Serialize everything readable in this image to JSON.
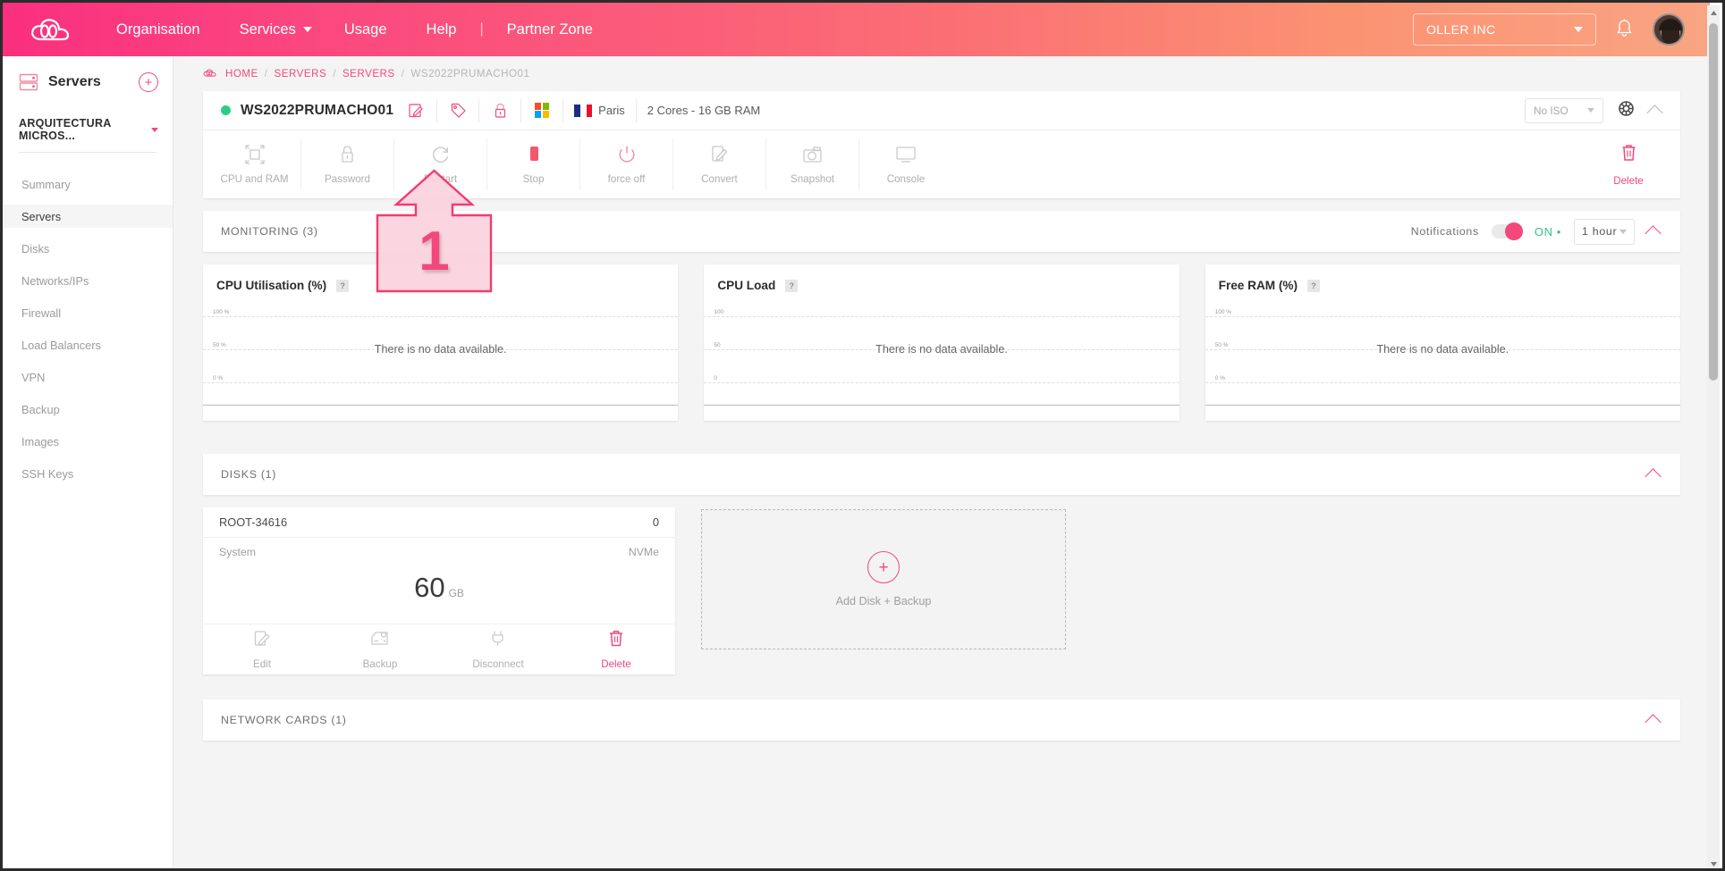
{
  "topbar": {
    "logo_icon": "cloud-logo-icon",
    "nav": [
      {
        "label": "Organisation",
        "caret": false
      },
      {
        "label": "Services",
        "caret": true
      },
      {
        "label": "Usage",
        "caret": false
      },
      {
        "label": "Help",
        "caret": false
      },
      {
        "label": "Partner Zone",
        "caret": false
      }
    ],
    "separator": "|",
    "org_selector": "OLLER INC",
    "bell_icon": "notification-bell-icon",
    "avatar_icon": "user-avatar"
  },
  "sidebar": {
    "title": "Servers",
    "title_icon": "server-rack-icon",
    "add_button": "+",
    "project": "ARQUITECTURA MICROS...",
    "items": [
      {
        "label": "Summary",
        "active": false
      },
      {
        "label": "Servers",
        "active": true
      },
      {
        "label": "Disks",
        "active": false
      },
      {
        "label": "Networks/IPs",
        "active": false
      },
      {
        "label": "Firewall",
        "active": false
      },
      {
        "label": "Load Balancers",
        "active": false
      },
      {
        "label": "VPN",
        "active": false
      },
      {
        "label": "Backup",
        "active": false
      },
      {
        "label": "Images",
        "active": false
      },
      {
        "label": "SSH Keys",
        "active": false
      }
    ]
  },
  "breadcrumb": {
    "icon": "cloud-icon",
    "items": [
      "HOME",
      "SERVERS",
      "SERVERS"
    ],
    "current": "WS2022PRUMACHO01",
    "separator": "/"
  },
  "server_header": {
    "status": "running",
    "name": "WS2022PRUMACHO01",
    "edit_icon": "edit-pencil-icon",
    "tag_icon": "tag-icon",
    "lock_icon": "lock-icon",
    "os_icon": "windows-logo-icon",
    "location": "Paris",
    "flag_icon": "france-flag-icon",
    "specs": "2 Cores - 16 GB RAM",
    "iso_select": "No ISO",
    "settings_icon": "gear-icon",
    "collapse_icon": "chevron-up-icon"
  },
  "actions": [
    {
      "label": "CPU and RAM",
      "icon": "resize-cpu-ram-icon"
    },
    {
      "label": "Password",
      "icon": "lock-password-icon"
    },
    {
      "label": "Restart",
      "icon": "restart-refresh-icon"
    },
    {
      "label": "Stop",
      "icon": "stop-square-icon"
    },
    {
      "label": "force off",
      "icon": "power-off-icon"
    },
    {
      "label": "Convert",
      "icon": "convert-pencil-icon"
    },
    {
      "label": "Snapshot",
      "icon": "camera-snapshot-icon"
    },
    {
      "label": "Console",
      "icon": "monitor-console-icon"
    }
  ],
  "delete_action": {
    "label": "Delete",
    "icon": "trash-delete-icon"
  },
  "monitoring": {
    "title": "MONITORING (3)",
    "notifications_label": "Notifications",
    "toggle_state": "ON",
    "toggle_dot": "•",
    "range": "1 hour",
    "collapse_icon": "chevron-up-icon"
  },
  "chart_data": [
    {
      "type": "line",
      "title": "CPU Utilisation (%)",
      "help_icon": "?",
      "empty_message": "There is no data available.",
      "ytick_labels": [
        "100 %",
        "50 %",
        "0 %"
      ],
      "ylim": [
        0,
        100
      ],
      "xlabel": "",
      "ylabel": "",
      "series": [],
      "grid": true
    },
    {
      "type": "line",
      "title": "CPU Load",
      "help_icon": "?",
      "empty_message": "There is no data available.",
      "ytick_labels": [
        "100",
        "50",
        "0"
      ],
      "ylim": [
        0,
        100
      ],
      "xlabel": "",
      "ylabel": "",
      "series": [],
      "grid": true
    },
    {
      "type": "line",
      "title": "Free RAM (%)",
      "help_icon": "?",
      "empty_message": "There is no data available.",
      "ytick_labels": [
        "100 %",
        "50 %",
        "0 %"
      ],
      "ylim": [
        0,
        100
      ],
      "xlabel": "",
      "ylabel": "",
      "series": [],
      "grid": true
    }
  ],
  "disks": {
    "title": "DISKS (1)",
    "collapse_icon": "chevron-up-icon",
    "disk": {
      "name": "ROOT-34616",
      "count": "0",
      "type_label": "System",
      "media": "NVMe",
      "size_value": "60",
      "size_unit": "GB",
      "actions": [
        {
          "label": "Edit",
          "icon": "edit-pencil-icon"
        },
        {
          "label": "Backup",
          "icon": "backup-disk-icon"
        },
        {
          "label": "Disconnect",
          "icon": "plug-disconnect-icon"
        },
        {
          "label": "Delete",
          "icon": "trash-delete-icon"
        }
      ]
    },
    "add_tile": {
      "label": "Add Disk + Backup",
      "icon": "plus-circle-icon"
    }
  },
  "network_cards": {
    "title": "NETWORK CARDS (1)",
    "collapse_icon": "chevron-up-icon"
  },
  "annotation": {
    "number": "1",
    "icon": "arrow-up-callout"
  },
  "colors": {
    "brand_pink": "#f2487c",
    "status_green": "#2ecc87",
    "toggle_on_green": "#37c18a"
  }
}
